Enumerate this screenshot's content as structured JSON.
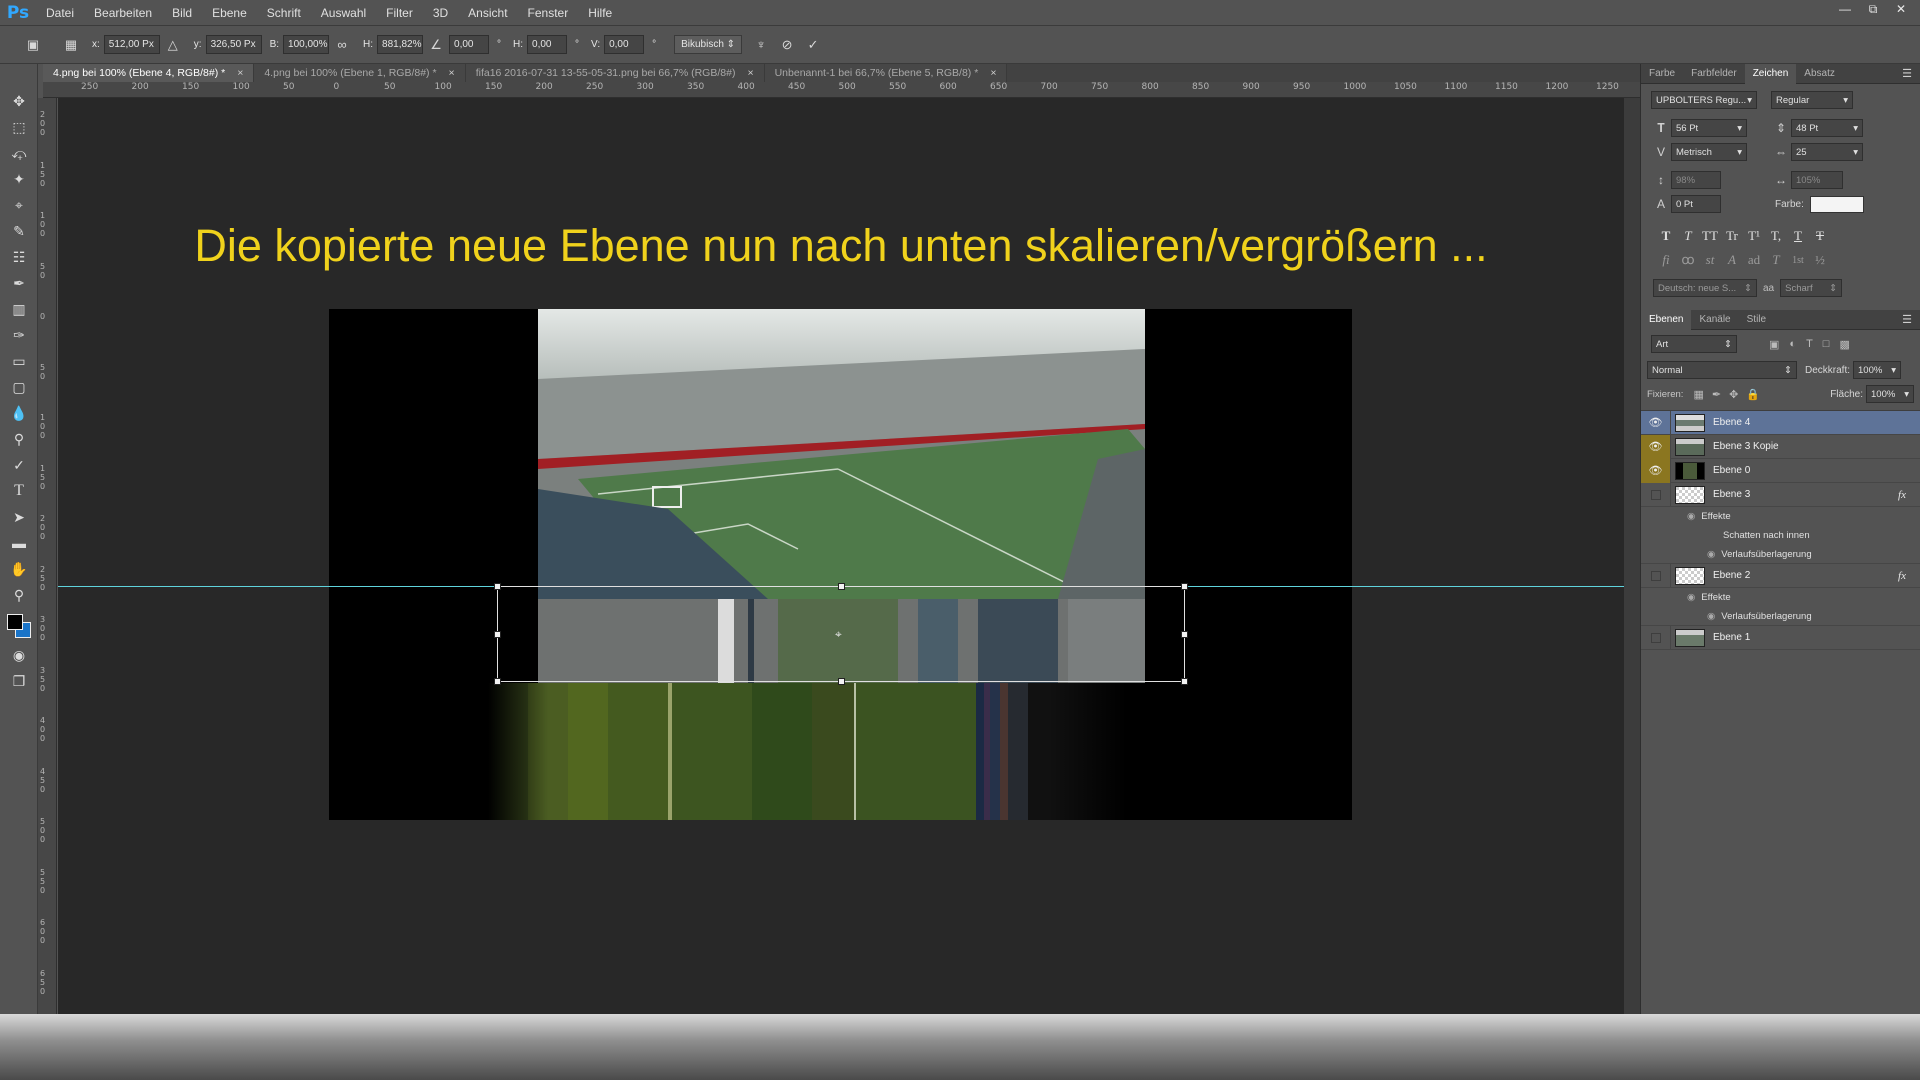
{
  "app": {
    "logo": "Ps"
  },
  "menu": [
    "Datei",
    "Bearbeiten",
    "Bild",
    "Ebene",
    "Schrift",
    "Auswahl",
    "Filter",
    "3D",
    "Ansicht",
    "Fenster",
    "Hilfe"
  ],
  "options": {
    "x_label": "x:",
    "x_value": "512,00 Px",
    "y_label": "y:",
    "y_value": "326,50 Px",
    "b_label": "B:",
    "b_value": "100,00%",
    "h_label": "H:",
    "h_value": "881,82%",
    "angle_value": "0,00",
    "angle_unit": "°",
    "hskew_label": "H:",
    "hskew_value": "0,00",
    "hskew_unit": "°",
    "vskew_label": "V:",
    "vskew_value": "0,00",
    "vskew_unit": "°",
    "interpolation": "Bikubisch"
  },
  "tabs": [
    {
      "label": "4.png bei 100% (Ebene 4, RGB/8#) *",
      "active": true
    },
    {
      "label": "4.png bei 100% (Ebene 1, RGB/8#) *",
      "active": false
    },
    {
      "label": "fifa16 2016-07-31 13-55-05-31.png bei 66,7% (RGB/8#)",
      "active": false
    },
    {
      "label": "Unbenannt-1 bei 66,7% (Ebene 5, RGB/8) *",
      "active": false
    }
  ],
  "ruler_top": [
    "250",
    "200",
    "150",
    "100",
    "50",
    "0",
    "50",
    "100",
    "150",
    "200",
    "250",
    "300",
    "350",
    "400",
    "450",
    "500",
    "550",
    "600",
    "650",
    "700",
    "750",
    "800",
    "850",
    "900",
    "950",
    "1000",
    "1050",
    "1100",
    "1150",
    "1200",
    "1250"
  ],
  "ruler_left": [
    "200",
    "150",
    "100",
    "50",
    "0",
    "50",
    "100",
    "150",
    "200",
    "250",
    "300",
    "350",
    "400",
    "450",
    "500",
    "550",
    "600",
    "650"
  ],
  "canvas": {
    "caption": "Die kopierte neue Ebene nun nach unten skalieren/vergrößern ..."
  },
  "character_panel": {
    "tabs": [
      "Farbe",
      "Farbfelder",
      "Zeichen",
      "Absatz"
    ],
    "font_family": "UPBOLTERS Regu...",
    "font_style": "Regular",
    "font_size": "56 Pt",
    "leading": "48 Pt",
    "kerning": "Metrisch",
    "tracking": "25",
    "vscale": "98%",
    "hscale": "105%",
    "baseline": "0 Pt",
    "color_label": "Farbe:",
    "style_buttons": [
      "T",
      "T",
      "TT",
      "Tr",
      "T¹",
      "T,",
      "T",
      "T"
    ],
    "opentype_buttons": [
      "fi",
      "ꝏ",
      "st",
      "A",
      "ad",
      "T",
      "1st",
      "½"
    ],
    "language": "Deutsch: neue S...",
    "aa_label": "aa",
    "antialias": "Scharf"
  },
  "layers_panel": {
    "tabs": [
      "Ebenen",
      "Kanäle",
      "Stile"
    ],
    "filter": "Art",
    "blend_mode": "Normal",
    "opacity_label": "Deckkraft:",
    "opacity": "100%",
    "lock_label": "Fixieren:",
    "fill_label": "Fläche:",
    "fill": "100%",
    "layers": [
      {
        "name": "Ebene 4",
        "visible": true,
        "selected": true
      },
      {
        "name": "Ebene 3 Kopie",
        "visible": true
      },
      {
        "name": "Ebene 0",
        "visible": true
      },
      {
        "name": "Ebene 3",
        "visible": false,
        "fx": "fx",
        "effects_label": "Effekte",
        "effects": [
          "Schatten nach innen",
          "Verlaufsüberlagerung"
        ]
      },
      {
        "name": "Ebene 2",
        "visible": false,
        "fx": "fx",
        "effects_label": "Effekte",
        "effects": [
          "Verlaufsüberlagerung"
        ]
      },
      {
        "name": "Ebene 1",
        "visible": false
      }
    ]
  },
  "colors": {
    "caption": "#f0d21c",
    "guide": "#5fd3dc",
    "selected_layer": "#5e7398",
    "visibility_highlight": "#8b7620",
    "ps_blue": "#31a8ff"
  }
}
